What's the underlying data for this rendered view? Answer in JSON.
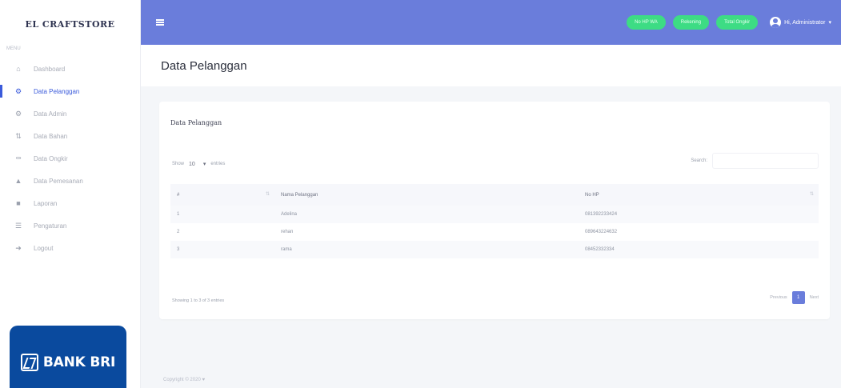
{
  "sidebar": {
    "brand": "EL CRAFTSTORE",
    "heading": "MENU",
    "items": [
      {
        "label": "Dashboard",
        "icon": "home-icon",
        "active": false
      },
      {
        "label": "Data Pelanggan",
        "icon": "users-icon",
        "active": true
      },
      {
        "label": "Data Admin",
        "icon": "user-cog-icon",
        "active": false
      },
      {
        "label": "Data Bahan",
        "icon": "box-icon",
        "active": false
      },
      {
        "label": "Data Ongkir",
        "icon": "truck-icon",
        "active": false
      },
      {
        "label": "Data Pemesanan",
        "icon": "cart-icon",
        "active": false
      },
      {
        "label": "Laporan",
        "icon": "report-icon",
        "active": false
      },
      {
        "label": "Pengaturan",
        "icon": "settings-icon",
        "active": false
      },
      {
        "label": "Logout",
        "icon": "logout-icon",
        "active": false
      }
    ],
    "sponsor": "BANK BRI"
  },
  "topbar": {
    "pills": [
      "No HP WA",
      "Rekening",
      "Total Ongkir"
    ],
    "user": "Hi, Administrator"
  },
  "page": {
    "title": "Data Pelanggan"
  },
  "card": {
    "title": "Data Pelanggan",
    "show_label": "Show",
    "entries_value": "10",
    "entries_label": "entries",
    "search_label": "Search:",
    "columns": [
      "#",
      "Nama Pelanggan",
      "No HP"
    ],
    "rows": [
      [
        "1",
        "Adelina",
        "081392233424"
      ],
      [
        "2",
        "rehan",
        "089643224632"
      ],
      [
        "3",
        "rama",
        "08452332334"
      ]
    ],
    "info": "Showing 1 to 3 of 3 entries",
    "pagination": {
      "previous": "Previous",
      "current": "1",
      "next": "Next"
    }
  },
  "footer": {
    "text": "Copyright © 2020 ♥"
  },
  "colors": {
    "topbar": "#6a7ddb",
    "accent": "#3b5bdb",
    "pill": "#3ddc84",
    "bri": "#0a4a9e"
  }
}
